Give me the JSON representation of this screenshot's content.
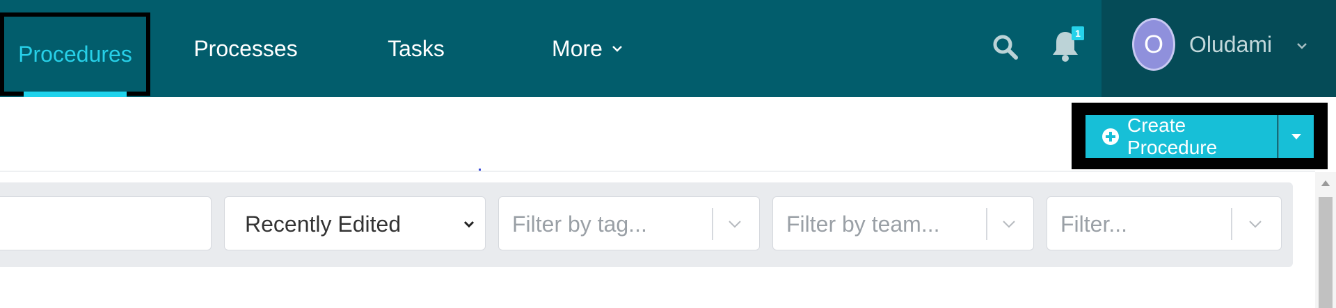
{
  "nav": {
    "items": [
      {
        "label": "Procedures",
        "active": true
      },
      {
        "label": "Processes"
      },
      {
        "label": "Tasks"
      },
      {
        "label": "More"
      }
    ],
    "notifications_count": "1",
    "user": {
      "initial": "O",
      "name": "Oludami"
    }
  },
  "actions": {
    "create_label": "Create Procedure"
  },
  "filters": {
    "search_value": "",
    "sort_selected": "Recently Edited",
    "tag_placeholder": "Filter by tag...",
    "team_placeholder": "Filter by team...",
    "other_placeholder": "Filter..."
  },
  "colors": {
    "nav_bg": "#025d6c",
    "active_accent": "#27d0e8",
    "button_bg": "#17bfd7",
    "avatar_bg": "#8f90dc"
  },
  "icons": [
    "search-icon",
    "bell-icon",
    "chevron-down-icon",
    "plus-circle-icon",
    "caret-down-icon"
  ]
}
